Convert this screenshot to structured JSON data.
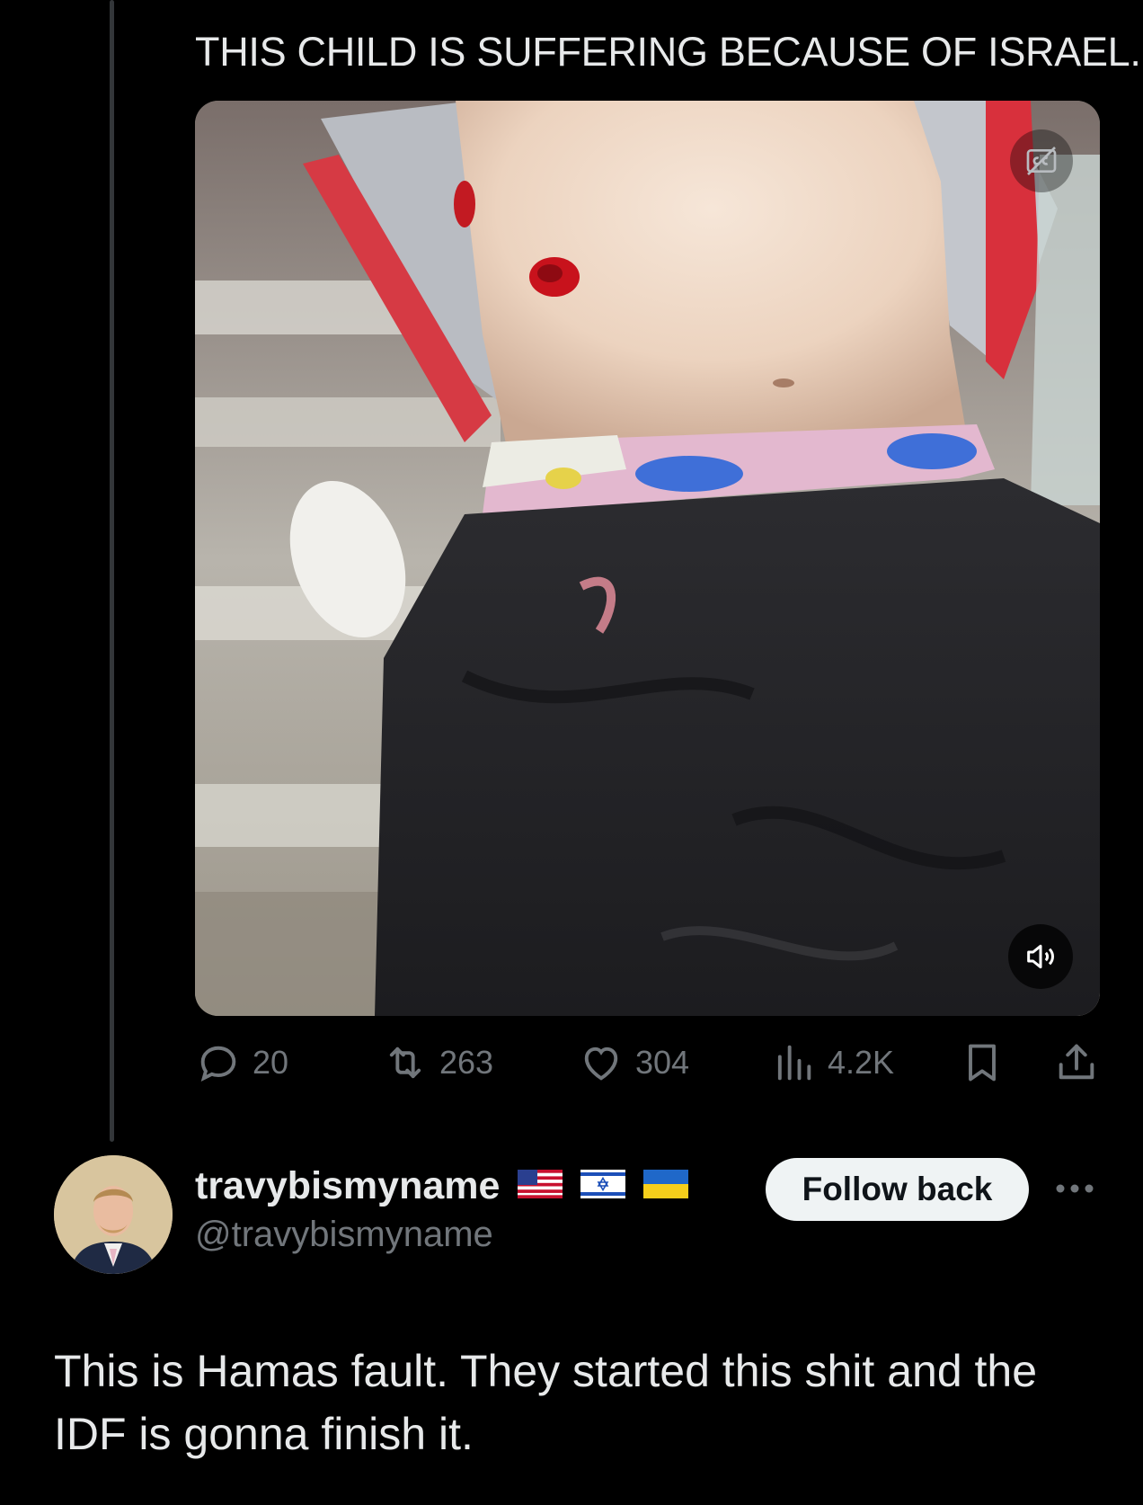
{
  "post": {
    "text": "THIS CHILD IS SUFFERING BECAUSE OF ISRAEL.",
    "media_controls": {
      "captions_icon": "captions-off-icon",
      "volume_icon": "speaker-muted-icon"
    },
    "actions": {
      "replies": "20",
      "reposts": "263",
      "likes": "304",
      "views": "4.2K"
    }
  },
  "reply": {
    "display_name": "travybismyname",
    "flags": [
      "us-flag-icon",
      "israel-flag-icon",
      "ukraine-flag-icon"
    ],
    "handle": "@travybismyname",
    "follow_label": "Follow back",
    "text": "This is Hamas fault. They started this shit and the IDF is gonna finish it."
  },
  "colors": {
    "background": "#000000",
    "text_primary": "#e7e9ea",
    "text_secondary": "#71767b",
    "follow_button_bg": "#eff3f4",
    "thread_line": "#333639"
  }
}
